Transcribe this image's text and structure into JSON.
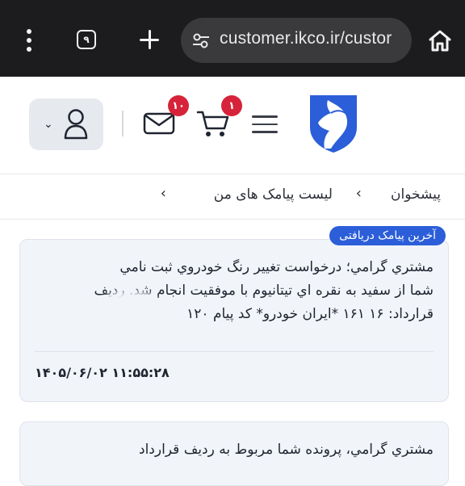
{
  "browser": {
    "menu_icon": "more-vert-icon",
    "tab_count": "۹",
    "new_tab_icon": "plus-icon",
    "url": "customer.ikco.ir/custor",
    "site_settings_icon": "tune-icon",
    "home_icon": "home-icon"
  },
  "header": {
    "user_icon": "user-icon",
    "dropdown_icon": "chevron-down-icon",
    "messages_badge": "۱۰",
    "cart_badge": "۱",
    "menu_icon": "hamburger-icon",
    "logo_icon": "horse-logo-icon",
    "brand_color": "#2b5ed8",
    "badge_color": "#d6233a"
  },
  "breadcrumb": {
    "items": [
      "پیشخوان",
      "لیست پیامک های من"
    ],
    "separator": "›"
  },
  "messages": [
    {
      "tag": "آخرین پیامک دریافتی",
      "lines": [
        "مشتري گرامي؛ درخواست تغيير رنگ خودروي ثبت نامي",
        "شما از سفيد به نقره اي تيتانيوم با موفقيت انجام شد. رديف",
        "قرارداد: ۱۶                ۱۶۱ *ايران خودرو* كد پيام ۱۲۰"
      ],
      "time": "۱۴۰۵/۰۶/۰۲ ۱۱:۵۵:۲۸"
    },
    {
      "lines": [
        "مشتري گرامي، پرونده شما مربوط به رديف قرارداد"
      ]
    }
  ]
}
